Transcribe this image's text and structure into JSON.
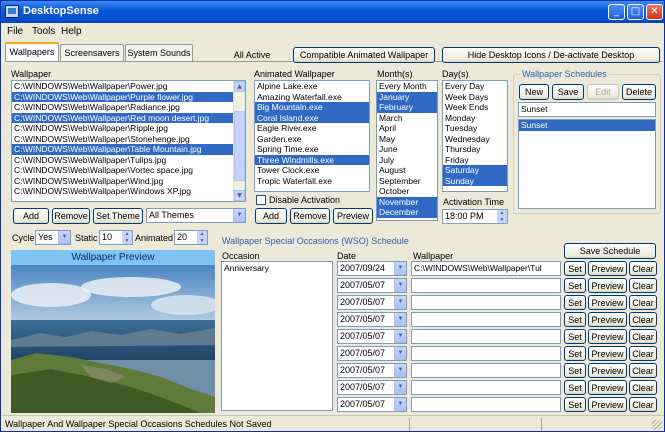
{
  "window": {
    "title": "DesktopSense",
    "minimize": "_",
    "maximize": "□",
    "close": "✕"
  },
  "menu": [
    "File",
    "Tools",
    "Help"
  ],
  "tabs": [
    "Wallpapers",
    "Screensavers",
    "System Sounds"
  ],
  "toolbar": {
    "all_active": "All Active",
    "compatible": "Compatible Animated Wallpaper",
    "hide_icons": "Hide Desktop Icons / De-activate Desktop"
  },
  "wallpaper": {
    "label": "Wallpaper",
    "items": [
      {
        "text": "C:\\WINDOWS\\Web\\Wallpaper\\Power.jpg",
        "selected": false
      },
      {
        "text": "C:\\WINDOWS\\Web\\Wallpaper\\Purple flower.jpg",
        "selected": true
      },
      {
        "text": "C:\\WINDOWS\\Web\\Wallpaper\\Radiance.jpg",
        "selected": false
      },
      {
        "text": "C:\\WINDOWS\\Web\\Wallpaper\\Red moon desert.jpg",
        "selected": true
      },
      {
        "text": "C:\\WINDOWS\\Web\\Wallpaper\\Ripple.jpg",
        "selected": false
      },
      {
        "text": "C:\\WINDOWS\\Web\\Wallpaper\\Stonehenge.jpg",
        "selected": false
      },
      {
        "text": "C:\\WINDOWS\\Web\\Wallpaper\\Table Mountain.jpg",
        "selected": true
      },
      {
        "text": "C:\\WINDOWS\\Web\\Wallpaper\\Tulips.jpg",
        "selected": false
      },
      {
        "text": "C:\\WINDOWS\\Web\\Wallpaper\\Vortec space.jpg",
        "selected": false
      },
      {
        "text": "C:\\WINDOWS\\Web\\Wallpaper\\Wind.jpg",
        "selected": false
      },
      {
        "text": "C:\\WINDOWS\\Web\\Wallpaper\\Windows XP.jpg",
        "selected": false
      }
    ],
    "add": "Add",
    "remove": "Remove",
    "set_theme": "Set Theme",
    "theme_value": "All Themes"
  },
  "animated": {
    "label": "Animated Wallpaper",
    "items": [
      {
        "text": "Alpine Lake.exe",
        "selected": false
      },
      {
        "text": "Amazing Waterfall.exe",
        "selected": false
      },
      {
        "text": "Big Mountain.exe",
        "selected": true
      },
      {
        "text": "Coral Island.exe",
        "selected": true
      },
      {
        "text": "Eagle River.exe",
        "selected": false
      },
      {
        "text": "Garden.exe",
        "selected": false
      },
      {
        "text": "Spring Time.exe",
        "selected": false
      },
      {
        "text": "Three Windmills.exe",
        "selected": true
      },
      {
        "text": "Tower Clock.exe",
        "selected": false
      },
      {
        "text": "Tropic Waterfall.exe",
        "selected": false
      }
    ],
    "disable": "Disable Activation",
    "add": "Add",
    "remove": "Remove",
    "preview": "Preview"
  },
  "months": {
    "label": "Month(s)",
    "items": [
      {
        "text": "Every Month",
        "selected": false
      },
      {
        "text": "January",
        "selected": true
      },
      {
        "text": "February",
        "selected": true
      },
      {
        "text": "March",
        "selected": false
      },
      {
        "text": "April",
        "selected": false
      },
      {
        "text": "May",
        "selected": false
      },
      {
        "text": "June",
        "selected": false
      },
      {
        "text": "July",
        "selected": false
      },
      {
        "text": "August",
        "selected": false
      },
      {
        "text": "September",
        "selected": false
      },
      {
        "text": "October",
        "selected": false
      },
      {
        "text": "November",
        "selected": true
      },
      {
        "text": "December",
        "selected": true
      }
    ]
  },
  "days": {
    "label": "Day(s)",
    "items": [
      {
        "text": "Every Day",
        "selected": false
      },
      {
        "text": "Week Days",
        "selected": false
      },
      {
        "text": "Week Ends",
        "selected": false
      },
      {
        "text": "Monday",
        "selected": false
      },
      {
        "text": "Tuesday",
        "selected": false
      },
      {
        "text": "Wednesday",
        "selected": false
      },
      {
        "text": "Thursday",
        "selected": false
      },
      {
        "text": "Friday",
        "selected": false
      },
      {
        "text": "Saturday",
        "selected": true
      },
      {
        "text": "Sunday",
        "selected": true
      }
    ],
    "activation_label": "Activation Time",
    "activation_time": "18:00 PM"
  },
  "schedules": {
    "label": "Wallpaper Schedules",
    "new": "New",
    "save": "Save",
    "edit": "Edit",
    "delete": "Delete",
    "name": "Sunset",
    "items": [
      {
        "text": "Sunset",
        "selected": true
      }
    ]
  },
  "cycle": {
    "label": "Cycle",
    "value": "Yes",
    "static_label": "Static",
    "static_value": "10",
    "animated_label": "Animated",
    "animated_value": "20"
  },
  "preview": {
    "label": "Wallpaper Preview"
  },
  "wso": {
    "label": "Wallpaper Special Occasions (WSO) Schedule",
    "save": "Save Schedule",
    "col_occasion": "Occasion",
    "col_date": "Date",
    "col_wallpaper": "Wallpaper",
    "set": "Set",
    "preview": "Preview",
    "clear": "Clear",
    "rows": [
      {
        "occasion": "Anniversary",
        "date": "2007/09/24",
        "wallpaper": "C:\\WINDOWS\\Web\\Wallpaper\\Tul"
      },
      {
        "occasion": "",
        "date": "2007/05/07",
        "wallpaper": ""
      },
      {
        "occasion": "",
        "date": "2007/05/07",
        "wallpaper": ""
      },
      {
        "occasion": "",
        "date": "2007/05/07",
        "wallpaper": ""
      },
      {
        "occasion": "",
        "date": "2007/05/07",
        "wallpaper": ""
      },
      {
        "occasion": "",
        "date": "2007/05/07",
        "wallpaper": ""
      },
      {
        "occasion": "",
        "date": "2007/05/07",
        "wallpaper": ""
      },
      {
        "occasion": "",
        "date": "2007/05/07",
        "wallpaper": ""
      },
      {
        "occasion": "",
        "date": "2007/05/07",
        "wallpaper": ""
      }
    ]
  },
  "status": {
    "text": "Wallpaper And Wallpaper Special Occasions Schedules Not Saved"
  },
  "colors": {
    "titlebar": "#0a5ad8",
    "selection": "#316ac5",
    "group_label": "#2f5fb0",
    "preview_header": "#7ec3f2"
  }
}
